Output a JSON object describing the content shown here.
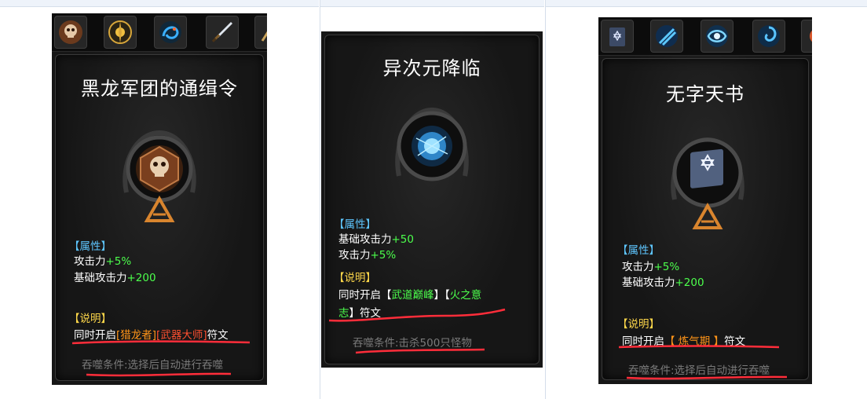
{
  "page": {
    "background": "#ffffff",
    "divider": "#d5deea"
  },
  "colors": {
    "green": "#4cff4c",
    "blue": "#5ec6ff",
    "yellow": "#ffd84a",
    "red": "#ff5030",
    "orange": "#ff9418",
    "gray": "#7a7a7a",
    "underline": "#ff2d3a"
  },
  "cards": [
    {
      "icons": [
        "skull-rune-icon",
        "golden-compass-icon",
        "blue-dragon-icon",
        "sword-icon",
        "partial-icon"
      ],
      "title": "黑龙军团的通缉令",
      "orb": "skull-emblem",
      "attributes_header": "【属性】",
      "attributes": [
        {
          "label": "攻击力",
          "value": "+5%"
        },
        {
          "label": "基础攻击力",
          "value": "+200"
        }
      ],
      "description_header": "【说明】",
      "description": {
        "prefix": "同时开启",
        "tag1": "[猎龙者]",
        "tag2": "[武器大师]",
        "suffix": "符文"
      },
      "condition": "吞噬条件:选择后自动进行吞噬"
    },
    {
      "icons": [],
      "title": "异次元降临",
      "orb": "blue-energy-orb",
      "attributes_header": "【属性】",
      "attributes": [
        {
          "label": "基础攻击力",
          "value": "+50"
        },
        {
          "label": "攻击力",
          "value": "+5%"
        }
      ],
      "description_header": "【说明】",
      "description": {
        "prefix": "同时开启【",
        "tag1": "武道巅峰",
        "mid": "】【",
        "tag2a": "火之意",
        "tag2b": "志",
        "suffix": "】符文"
      },
      "condition": "吞噬条件:击杀500只怪物"
    },
    {
      "icons": [
        "book-icon",
        "blue-slash-icon",
        "blue-vortex-icon",
        "blue-swirl-icon",
        "partial-icon"
      ],
      "title": "无字天书",
      "orb": "blank-book",
      "attributes_header": "【属性】",
      "attributes": [
        {
          "label": "攻击力",
          "value": "+5%"
        },
        {
          "label": "基础攻击力",
          "value": "+200"
        }
      ],
      "description_header": "【说明】",
      "description": {
        "prefix": "同时开启",
        "tag1": "【 炼气期 】",
        "suffix": "符文"
      },
      "condition": "吞噬条件:选择后自动进行吞噬"
    }
  ]
}
